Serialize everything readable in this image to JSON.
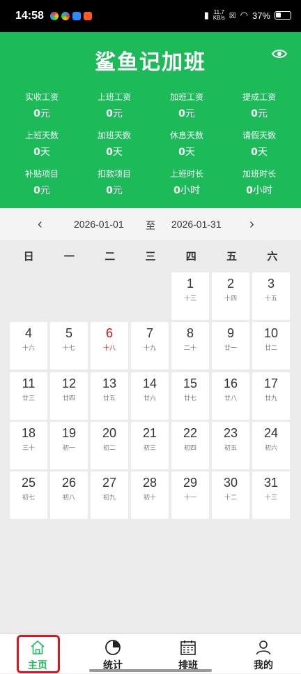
{
  "status_bar": {
    "time": "14:58",
    "speed_top": "11.7",
    "speed_bottom": "KB/s",
    "battery": "37%"
  },
  "header": {
    "title": "鲨鱼记加班",
    "visibility_icon": "eye-icon",
    "stats": [
      {
        "label": "实收工资",
        "value": "0",
        "unit": "元"
      },
      {
        "label": "上班工资",
        "value": "0",
        "unit": "元"
      },
      {
        "label": "加班工资",
        "value": "0",
        "unit": "元"
      },
      {
        "label": "提成工资",
        "value": "0",
        "unit": "元"
      },
      {
        "label": "上班天数",
        "value": "0",
        "unit": "天"
      },
      {
        "label": "加班天数",
        "value": "0",
        "unit": "天"
      },
      {
        "label": "休息天数",
        "value": "0",
        "unit": "天"
      },
      {
        "label": "请假天数",
        "value": "0",
        "unit": "天"
      },
      {
        "label": "补贴项目",
        "value": "0",
        "unit": "元"
      },
      {
        "label": "扣款项目",
        "value": "0",
        "unit": "元"
      },
      {
        "label": "上班时长",
        "value": "0",
        "unit": "小时"
      },
      {
        "label": "加班时长",
        "value": "0",
        "unit": "小时"
      }
    ]
  },
  "date_range": {
    "start": "2026-01-01",
    "separator": "至",
    "end": "2026-01-31",
    "prev_icon": "chevron-left-icon",
    "next_icon": "chevron-right-icon"
  },
  "calendar": {
    "weekdays": [
      "日",
      "一",
      "二",
      "三",
      "四",
      "五",
      "六"
    ],
    "leading_blanks": 4,
    "today": 6,
    "today_color": "#d01010",
    "days": [
      {
        "day": "1",
        "lunar": "十三"
      },
      {
        "day": "2",
        "lunar": "十四"
      },
      {
        "day": "3",
        "lunar": "十五"
      },
      {
        "day": "4",
        "lunar": "十六"
      },
      {
        "day": "5",
        "lunar": "十七"
      },
      {
        "day": "6",
        "lunar": "十八"
      },
      {
        "day": "7",
        "lunar": "十九"
      },
      {
        "day": "8",
        "lunar": "二十"
      },
      {
        "day": "9",
        "lunar": "廿一"
      },
      {
        "day": "10",
        "lunar": "廿二"
      },
      {
        "day": "11",
        "lunar": "廿三"
      },
      {
        "day": "12",
        "lunar": "廿四"
      },
      {
        "day": "13",
        "lunar": "廿五"
      },
      {
        "day": "14",
        "lunar": "廿六"
      },
      {
        "day": "15",
        "lunar": "廿七"
      },
      {
        "day": "16",
        "lunar": "廿八"
      },
      {
        "day": "17",
        "lunar": "廿九"
      },
      {
        "day": "18",
        "lunar": "三十"
      },
      {
        "day": "19",
        "lunar": "初一"
      },
      {
        "day": "20",
        "lunar": "初二"
      },
      {
        "day": "21",
        "lunar": "初三"
      },
      {
        "day": "22",
        "lunar": "初四"
      },
      {
        "day": "23",
        "lunar": "初五"
      },
      {
        "day": "24",
        "lunar": "初六"
      },
      {
        "day": "25",
        "lunar": "初七"
      },
      {
        "day": "26",
        "lunar": "初八"
      },
      {
        "day": "27",
        "lunar": "初九"
      },
      {
        "day": "28",
        "lunar": "初十"
      },
      {
        "day": "29",
        "lunar": "十一"
      },
      {
        "day": "30",
        "lunar": "十二"
      },
      {
        "day": "31",
        "lunar": "十三"
      }
    ]
  },
  "tabs": [
    {
      "label": "主页",
      "icon": "home-icon",
      "active": true
    },
    {
      "label": "统计",
      "icon": "pie-chart-icon",
      "active": false
    },
    {
      "label": "排班",
      "icon": "calendar-icon",
      "active": false
    },
    {
      "label": "我的",
      "icon": "user-icon",
      "active": false
    }
  ],
  "colors": {
    "brand_green": "#1dba5a",
    "highlight_red": "#e0141e"
  }
}
